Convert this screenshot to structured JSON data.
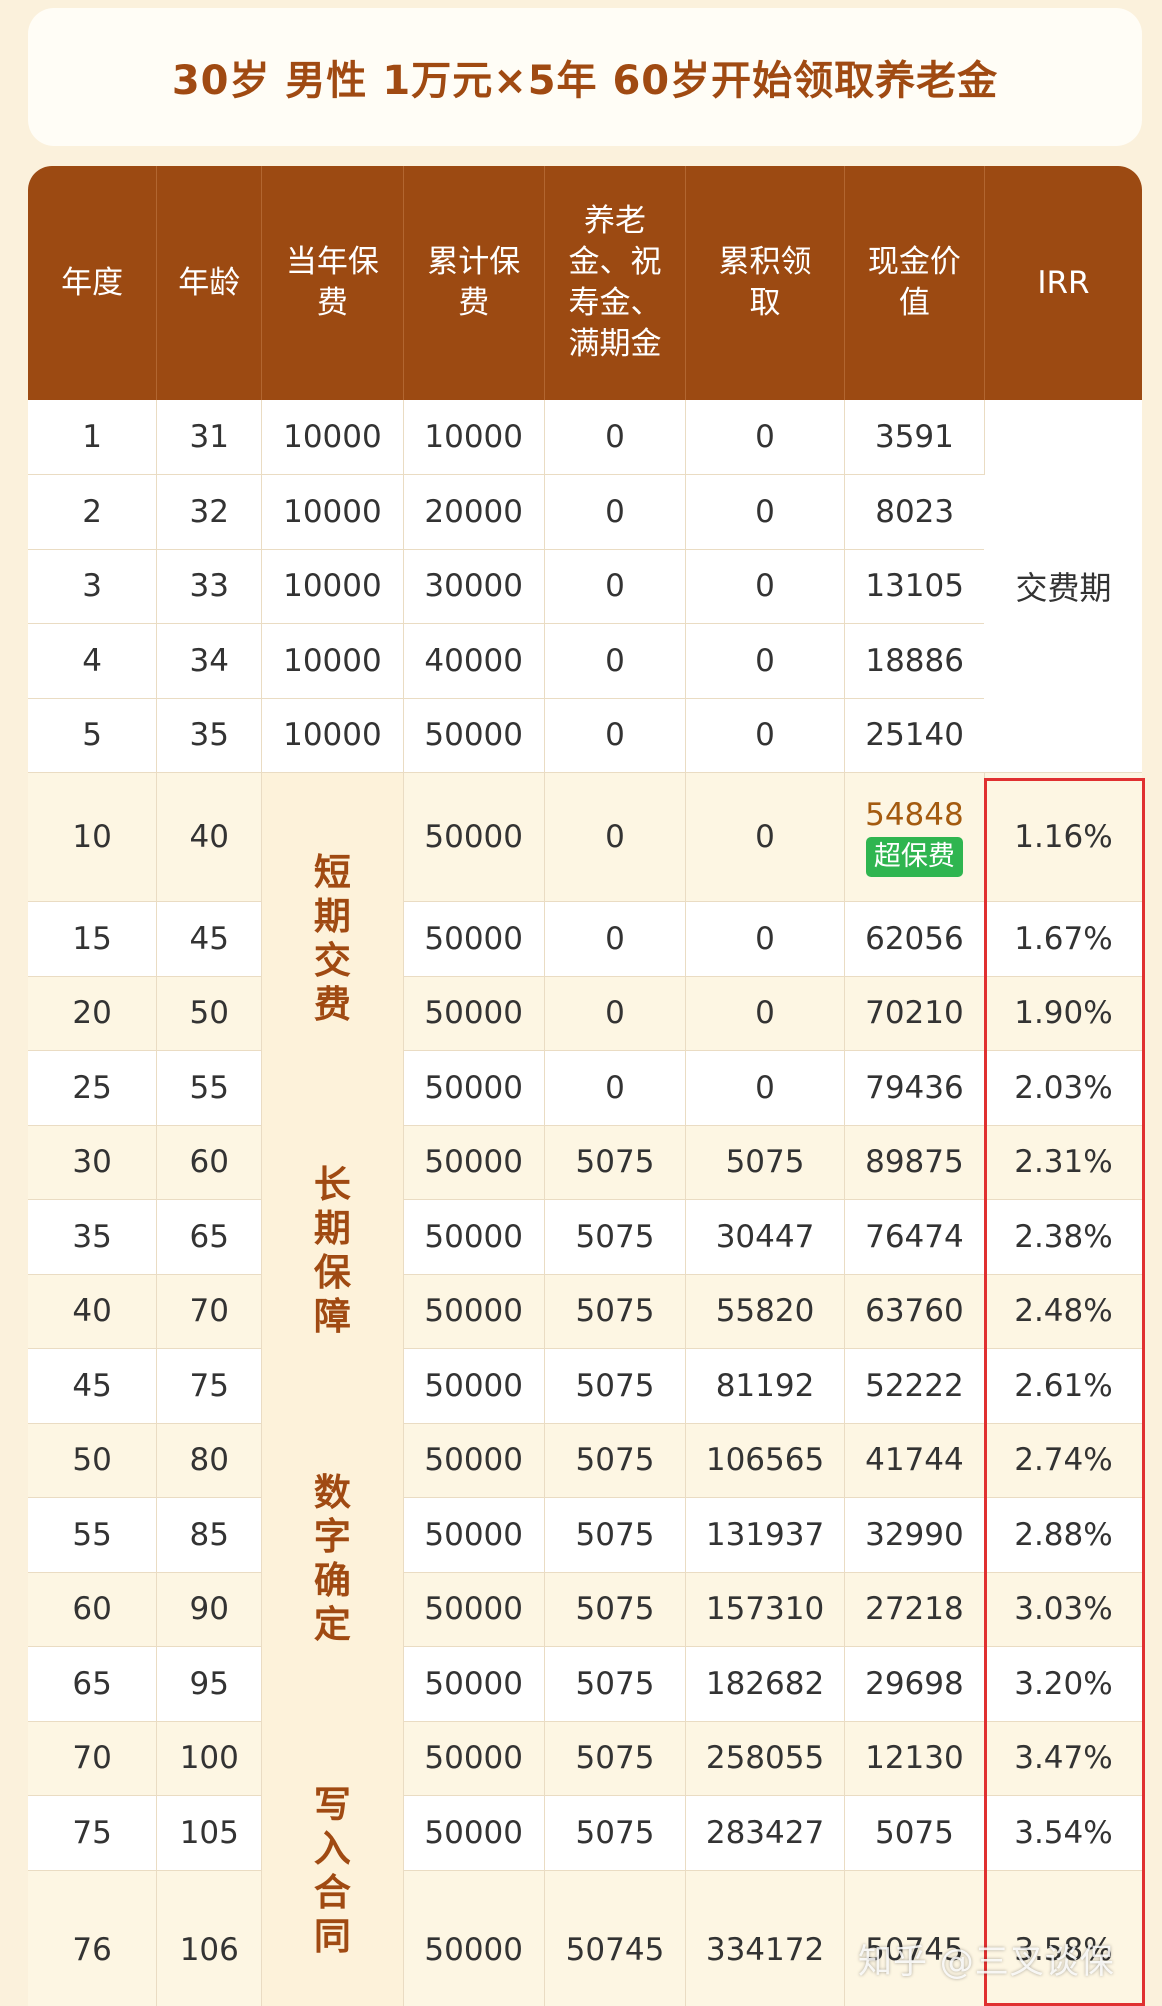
{
  "title": "30岁 男性 1万元×5年 60岁开始领取养老金",
  "headers": {
    "year": "年度",
    "age": "年龄",
    "annual_premium": [
      "当年保",
      "费"
    ],
    "total_premium": [
      "累计保",
      "费"
    ],
    "pension": [
      "养老",
      "金、祝",
      "寿金、",
      "满期金"
    ],
    "cumulative_received": [
      "累积领",
      "取"
    ],
    "cash_value": [
      "现金价",
      "值"
    ],
    "irr": "IRR"
  },
  "pay_period_label": "交费期",
  "merged_labels": [
    [
      "短",
      "期",
      "交",
      "费"
    ],
    [
      "长",
      "期",
      "保",
      "障"
    ],
    [
      "数",
      "字",
      "确",
      "定"
    ],
    [
      "写",
      "入",
      "合",
      "同"
    ]
  ],
  "cash_value_badge": "超保费",
  "pay_rows": [
    {
      "year": "1",
      "age": "31",
      "annual": "10000",
      "total": "10000",
      "pension": "0",
      "cumulative": "0",
      "cash": "3591"
    },
    {
      "year": "2",
      "age": "32",
      "annual": "10000",
      "total": "20000",
      "pension": "0",
      "cumulative": "0",
      "cash": "8023"
    },
    {
      "year": "3",
      "age": "33",
      "annual": "10000",
      "total": "30000",
      "pension": "0",
      "cumulative": "0",
      "cash": "13105"
    },
    {
      "year": "4",
      "age": "34",
      "annual": "10000",
      "total": "40000",
      "pension": "0",
      "cumulative": "0",
      "cash": "18886"
    },
    {
      "year": "5",
      "age": "35",
      "annual": "10000",
      "total": "50000",
      "pension": "0",
      "cumulative": "0",
      "cash": "25140"
    }
  ],
  "later_rows": [
    {
      "year": "10",
      "age": "40",
      "total": "50000",
      "pension": "0",
      "cumulative": "0",
      "cash": "54848",
      "irr": "1.16%"
    },
    {
      "year": "15",
      "age": "45",
      "total": "50000",
      "pension": "0",
      "cumulative": "0",
      "cash": "62056",
      "irr": "1.67%"
    },
    {
      "year": "20",
      "age": "50",
      "total": "50000",
      "pension": "0",
      "cumulative": "0",
      "cash": "70210",
      "irr": "1.90%"
    },
    {
      "year": "25",
      "age": "55",
      "total": "50000",
      "pension": "0",
      "cumulative": "0",
      "cash": "79436",
      "irr": "2.03%"
    },
    {
      "year": "30",
      "age": "60",
      "total": "50000",
      "pension": "5075",
      "cumulative": "5075",
      "cash": "89875",
      "irr": "2.31%"
    },
    {
      "year": "35",
      "age": "65",
      "total": "50000",
      "pension": "5075",
      "cumulative": "30447",
      "cash": "76474",
      "irr": "2.38%"
    },
    {
      "year": "40",
      "age": "70",
      "total": "50000",
      "pension": "5075",
      "cumulative": "55820",
      "cash": "63760",
      "irr": "2.48%"
    },
    {
      "year": "45",
      "age": "75",
      "total": "50000",
      "pension": "5075",
      "cumulative": "81192",
      "cash": "52222",
      "irr": "2.61%"
    },
    {
      "year": "50",
      "age": "80",
      "total": "50000",
      "pension": "5075",
      "cumulative": "106565",
      "cash": "41744",
      "irr": "2.74%"
    },
    {
      "year": "55",
      "age": "85",
      "total": "50000",
      "pension": "5075",
      "cumulative": "131937",
      "cash": "32990",
      "irr": "2.88%"
    },
    {
      "year": "60",
      "age": "90",
      "total": "50000",
      "pension": "5075",
      "cumulative": "157310",
      "cash": "27218",
      "irr": "3.03%"
    },
    {
      "year": "65",
      "age": "95",
      "total": "50000",
      "pension": "5075",
      "cumulative": "182682",
      "cash": "29698",
      "irr": "3.20%"
    },
    {
      "year": "70",
      "age": "100",
      "total": "50000",
      "pension": "5075",
      "cumulative": "258055",
      "cash": "12130",
      "irr": "3.47%"
    },
    {
      "year": "75",
      "age": "105",
      "total": "50000",
      "pension": "5075",
      "cumulative": "283427",
      "cash": "5075",
      "irr": "3.54%"
    },
    {
      "year": "76",
      "age": "106",
      "total": "50000",
      "pension": "50745",
      "cumulative": "334172",
      "cash": "50745",
      "irr": "3.58%"
    }
  ],
  "watermark": "知乎 @三叉谈保",
  "colors": {
    "header_bg": "#9c4a12",
    "title_text": "#a04a12",
    "badge_bg": "#2fb550",
    "highlight_border": "#e03030"
  }
}
